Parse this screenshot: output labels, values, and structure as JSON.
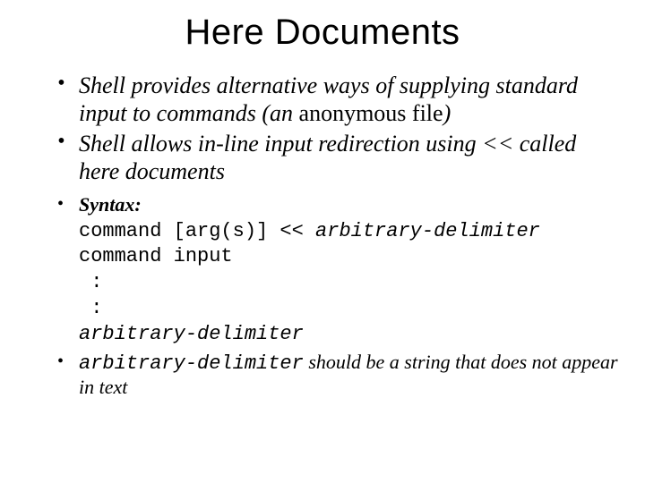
{
  "title": "Here Documents",
  "bullets": {
    "b1_a": "Shell provides alternative ways of supplying standard input to commands (an",
    "b1_b": " anonymous file",
    "b1_c": ")",
    "b2": "Shell allows in-line input redirection using << called here documents",
    "b3_label": "Syntax:",
    "b3_code_a": "command [arg(s)] << ",
    "b3_code_b": "arbitrary-delimiter",
    "b3_code_c": "command input\n :\n :",
    "b3_code_d": "arbitrary-delimiter",
    "b4_a": "arbitrary-delimiter",
    "b4_b": " should be a string that does not appear in text"
  }
}
